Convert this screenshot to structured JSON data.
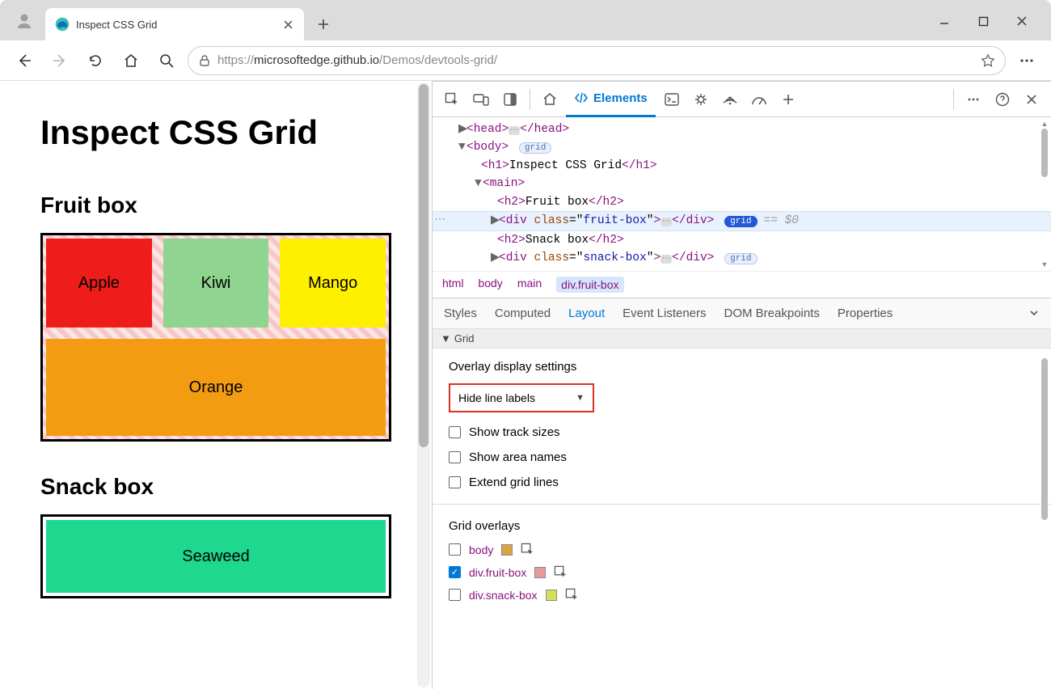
{
  "browser": {
    "tab_title": "Inspect CSS Grid",
    "url_prefix": "https://",
    "url_host": "microsoftedge.github.io",
    "url_path": "/Demos/devtools-grid/"
  },
  "page": {
    "h1": "Inspect CSS Grid",
    "fruit_heading": "Fruit box",
    "snack_heading": "Snack box",
    "cells": {
      "apple": "Apple",
      "kiwi": "Kiwi",
      "mango": "Mango",
      "orange": "Orange",
      "seaweed": "Seaweed"
    }
  },
  "devtools": {
    "elements_label": "Elements",
    "dom": {
      "head": "head",
      "body": "body",
      "grid_badge": "grid",
      "h1_text": "Inspect CSS Grid",
      "main": "main",
      "h2_fruit": "Fruit box",
      "fruit_class": "fruit-box",
      "h2_snack": "Snack box",
      "snack_class": "snack-box",
      "eq0": "== $0"
    },
    "breadcrumb": [
      "html",
      "body",
      "main",
      "div.fruit-box"
    ],
    "subtabs": [
      "Styles",
      "Computed",
      "Layout",
      "Event Listeners",
      "DOM Breakpoints",
      "Properties"
    ],
    "grid_section": "Grid",
    "overlay_settings": "Overlay display settings",
    "select_value": "Hide line labels",
    "checks": {
      "track": "Show track sizes",
      "area": "Show area names",
      "extend": "Extend grid lines"
    },
    "overlays_title": "Grid overlays",
    "overlays": [
      {
        "sel": "body",
        "color": "#d9a441",
        "checked": false
      },
      {
        "sel": "div.fruit-box",
        "color": "#e89999",
        "checked": true
      },
      {
        "sel": "div.snack-box",
        "color": "#d4e157",
        "checked": false
      }
    ]
  }
}
